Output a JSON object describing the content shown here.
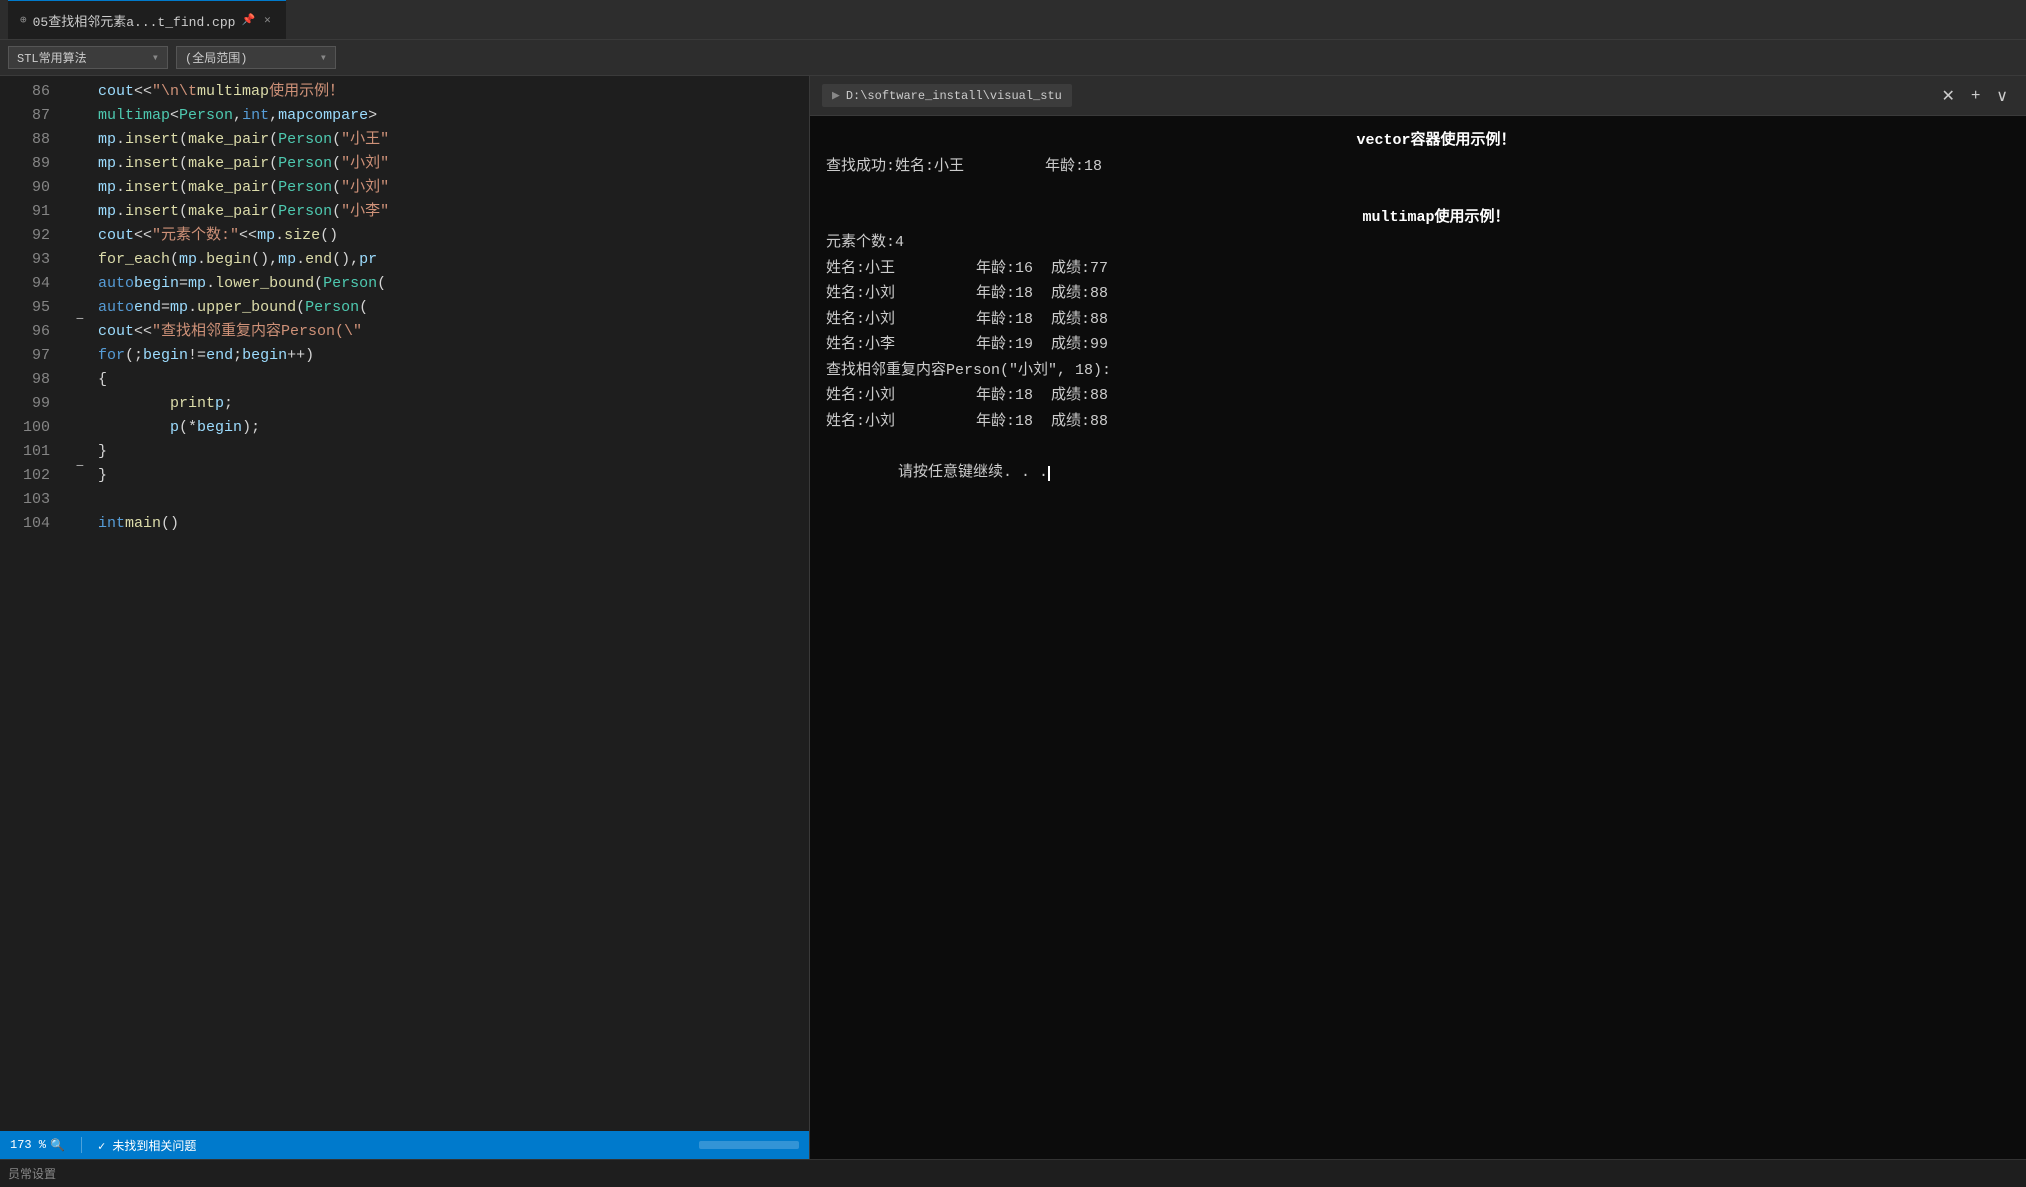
{
  "titleBar": {
    "tab": {
      "label": "05查找相邻元素a...t_find.cpp",
      "pinIcon": "📌",
      "closeIcon": "✕"
    }
  },
  "toolbar": {
    "leftDropdown": "STL常用算法",
    "rightDropdown": "(全局范围)"
  },
  "editor": {
    "lines": [
      {
        "num": 86,
        "fold": "",
        "code": "cout << \"\\n\\tmultimap使用示例！"
      },
      {
        "num": 87,
        "fold": "",
        "code": "multimap<Person, int, mapcompare>"
      },
      {
        "num": 88,
        "fold": "",
        "code": "mp.insert(make_pair(Person(\"小王\""
      },
      {
        "num": 89,
        "fold": "",
        "code": "mp.insert(make_pair(Person(\"小刘\""
      },
      {
        "num": 90,
        "fold": "",
        "code": "mp.insert(make_pair(Person(\"小刘\""
      },
      {
        "num": 91,
        "fold": "",
        "code": "mp.insert(make_pair(Person(\"小李\""
      },
      {
        "num": 92,
        "fold": "",
        "code": "cout << \"元素个数:\" << mp.size()"
      },
      {
        "num": 93,
        "fold": "",
        "code": "for_each(mp.begin(), mp.end(), pr"
      },
      {
        "num": 94,
        "fold": "",
        "code": "auto begin=mp.lower_bound(Person("
      },
      {
        "num": 95,
        "fold": "",
        "code": "auto end = mp.upper_bound(Person("
      },
      {
        "num": 96,
        "fold": "",
        "code": "cout << \"查找相邻重复内容Person(\\"
      },
      {
        "num": 97,
        "fold": "−",
        "code": "for (; begin != end; begin++)"
      },
      {
        "num": 98,
        "fold": "",
        "code": "{"
      },
      {
        "num": 99,
        "fold": "",
        "code": "    print p;"
      },
      {
        "num": 100,
        "fold": "",
        "code": "    p(*begin);"
      },
      {
        "num": 101,
        "fold": "",
        "code": "}"
      },
      {
        "num": 102,
        "fold": "",
        "code": "}"
      },
      {
        "num": 103,
        "fold": "",
        "code": ""
      },
      {
        "num": 104,
        "fold": "−",
        "code": "int main()"
      }
    ]
  },
  "statusBar": {
    "zoom": "173 %",
    "status": "✓ 未找到相关问题"
  },
  "terminal": {
    "tabLabel": "D:\\software_install\\visual_stu",
    "addIcon": "+",
    "chevronIcon": "∨",
    "closeIcon": "✕",
    "output": [
      {
        "text": "vector容器使用示例！",
        "style": "center-bold"
      },
      {
        "text": "查找成功:姓名:小王         年龄:18",
        "style": "normal"
      },
      {
        "text": "",
        "style": "normal"
      },
      {
        "text": "    multimap使用示例！",
        "style": "center-bold"
      },
      {
        "text": "元素个数:4",
        "style": "normal"
      },
      {
        "text": "姓名:小王         年龄:16  成绩:77",
        "style": "normal"
      },
      {
        "text": "姓名:小刘         年龄:18  成绩:88",
        "style": "normal"
      },
      {
        "text": "姓名:小刘         年龄:18  成绩:88",
        "style": "normal"
      },
      {
        "text": "姓名:小李         年龄:19  成绩:99",
        "style": "normal"
      },
      {
        "text": "查找相邻重复内容Person(\"小刘\", 18):",
        "style": "normal"
      },
      {
        "text": "姓名:小刘         年龄:18  成绩:88",
        "style": "normal"
      },
      {
        "text": "姓名:小刘         年龄:18  成绩:88",
        "style": "normal"
      },
      {
        "text": "请按任意键继续. . .",
        "style": "cursor"
      }
    ]
  }
}
